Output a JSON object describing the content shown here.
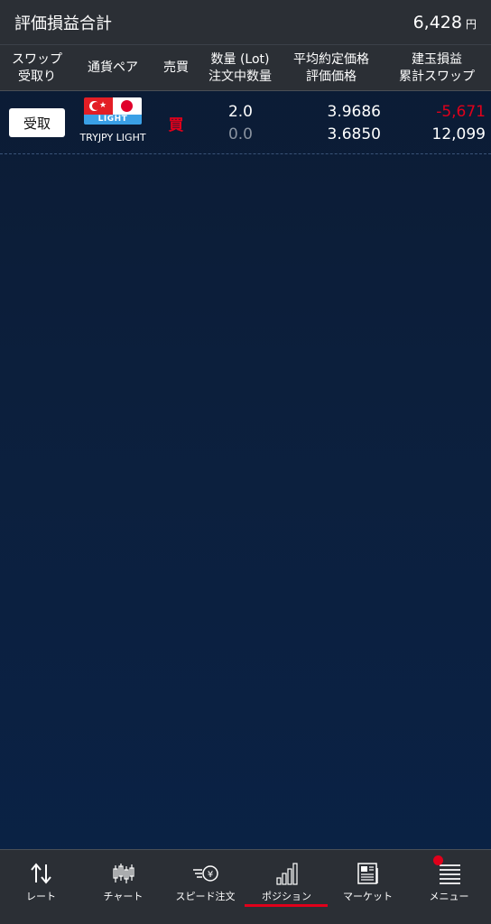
{
  "summary": {
    "title": "評価損益合計",
    "value": "6,428",
    "unit": "円"
  },
  "header": {
    "col_swap_line1": "スワップ",
    "col_swap_line2": "受取り",
    "col_pair": "通貨ペア",
    "col_side": "売買",
    "col_qty_line1": "数量 (Lot)",
    "col_qty_line2": "注文中数量",
    "col_price_line1": "平均約定価格",
    "col_price_line2": "評価価格",
    "col_pl_line1": "建玉損益",
    "col_pl_line2": "累計スワップ"
  },
  "position": {
    "receive_button": "受取",
    "pair_name": "TRYJPY LIGHT",
    "flag_label": "LIGHT",
    "side": "買",
    "quantity": "2.0",
    "ordered_quantity": "0.0",
    "avg_price": "3.9686",
    "eval_price": "3.6850",
    "position_pl": "-5,671",
    "cumulative_swap": "12,099",
    "colors": {
      "side": "#e0001b",
      "negative": "#e0001b",
      "muted": "#8a93a0"
    }
  },
  "nav": {
    "items": [
      {
        "label": "レート",
        "icon": "rate-arrows-icon"
      },
      {
        "label": "チャート",
        "icon": "candlestick-icon"
      },
      {
        "label": "スピード注文",
        "icon": "speed-order-icon"
      },
      {
        "label": "ポジション",
        "icon": "position-bars-icon",
        "active": true
      },
      {
        "label": "マーケット",
        "icon": "newspaper-icon"
      },
      {
        "label": "メニュー",
        "icon": "menu-list-icon",
        "badge": true
      }
    ],
    "accent": "#e0001b"
  }
}
